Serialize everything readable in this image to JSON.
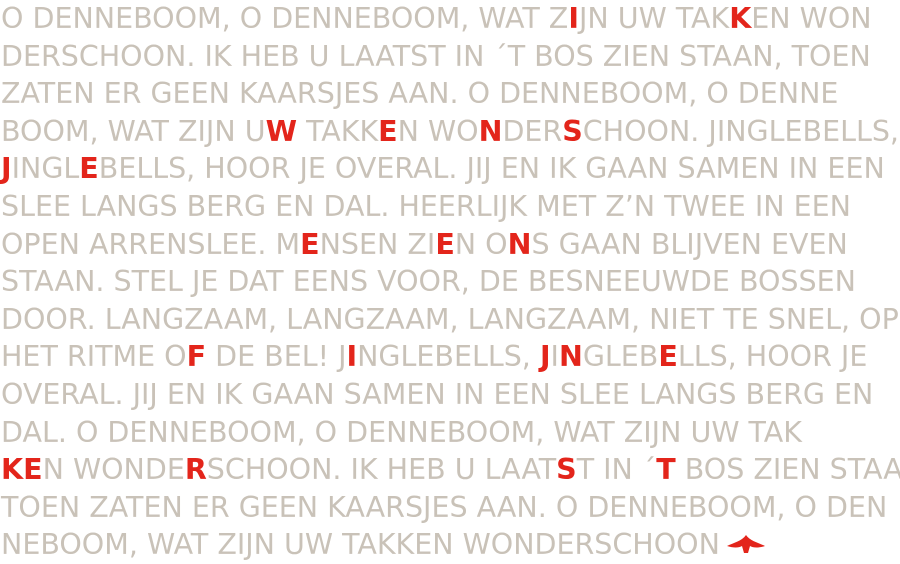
{
  "colors": {
    "text": "#c9c2b8",
    "highlight": "#e3251b",
    "background": "#ffffff"
  },
  "icon": "spade-ornament-icon",
  "lines": [
    [
      {
        "t": "O DENNEBOOM, O DENNEBOOM, WAT Z"
      },
      {
        "t": "I",
        "h": 1
      },
      {
        "t": "JN UW TAK"
      },
      {
        "t": "K",
        "h": 1
      },
      {
        "t": "EN WON"
      }
    ],
    [
      {
        "t": "DERSCHOON. IK HEB U LAATST IN ´T BOS ZIEN STAAN, TOEN"
      }
    ],
    [
      {
        "t": "ZATEN ER GEEN KAARSJES AAN. O DENNEBOOM, O DENNE"
      }
    ],
    [
      {
        "t": "BOOM, WAT ZIJN U"
      },
      {
        "t": "W",
        "h": 1
      },
      {
        "t": " TAKK"
      },
      {
        "t": "E",
        "h": 1
      },
      {
        "t": "N WO"
      },
      {
        "t": "N",
        "h": 1
      },
      {
        "t": "DER"
      },
      {
        "t": "S",
        "h": 1
      },
      {
        "t": "CHOON. JINGLEBELLS,"
      }
    ],
    [
      {
        "t": "J",
        "h": 1
      },
      {
        "t": "INGL"
      },
      {
        "t": "E",
        "h": 1
      },
      {
        "t": "BELLS, HOOR JE OVERAL. JIJ EN IK GAAN SAMEN IN EEN"
      }
    ],
    [
      {
        "t": "SLEE LANGS BERG EN DAL. HEERLIJK MET Z’N TWEE IN EEN"
      }
    ],
    [
      {
        "t": "OPEN ARRENSLEE. M"
      },
      {
        "t": "E",
        "h": 1
      },
      {
        "t": "NSEN ZI"
      },
      {
        "t": "E",
        "h": 1
      },
      {
        "t": "N O"
      },
      {
        "t": "N",
        "h": 1
      },
      {
        "t": "S GAAN BLIJVEN EVEN"
      }
    ],
    [
      {
        "t": "STAAN. STEL JE DAT EENS VOOR, DE BESNEEUWDE BOSSEN"
      }
    ],
    [
      {
        "t": "DOOR. LANGZAAM, LANGZAAM, LANGZAAM, NIET TE SNEL, OP"
      }
    ],
    [
      {
        "t": "HET RITME O"
      },
      {
        "t": "F",
        "h": 1
      },
      {
        "t": " DE BEL! J"
      },
      {
        "t": "I",
        "h": 1
      },
      {
        "t": "NGLEBELLS, "
      },
      {
        "t": "J",
        "h": 1
      },
      {
        "t": "I"
      },
      {
        "t": "N",
        "h": 1
      },
      {
        "t": "GLEB"
      },
      {
        "t": "E",
        "h": 1
      },
      {
        "t": "LLS, HOOR JE"
      }
    ],
    [
      {
        "t": "OVERAL. JIJ EN IK GAAN SAMEN IN EEN SLEE LANGS BERG EN"
      }
    ],
    [
      {
        "t": "DAL. O DENNEBOOM, O DENNEBOOM, WAT ZIJN UW TAK"
      }
    ],
    [
      {
        "t": "K",
        "h": 1
      },
      {
        "t": "E",
        "h": 1
      },
      {
        "t": "N WONDE"
      },
      {
        "t": "R",
        "h": 1
      },
      {
        "t": "SCHOON. IK HEB U LAAT"
      },
      {
        "t": "S",
        "h": 1
      },
      {
        "t": "T IN ´"
      },
      {
        "t": "T",
        "h": 1
      },
      {
        "t": " BOS ZIEN STAAN,"
      }
    ],
    [
      {
        "t": "TOEN ZATEN ER GEEN KAARSJES AAN. O DENNEBOOM, O DEN"
      }
    ],
    [
      {
        "t": "NEBOOM, WAT ZIJN UW TAKKEN WONDERSCHOON"
      }
    ]
  ]
}
